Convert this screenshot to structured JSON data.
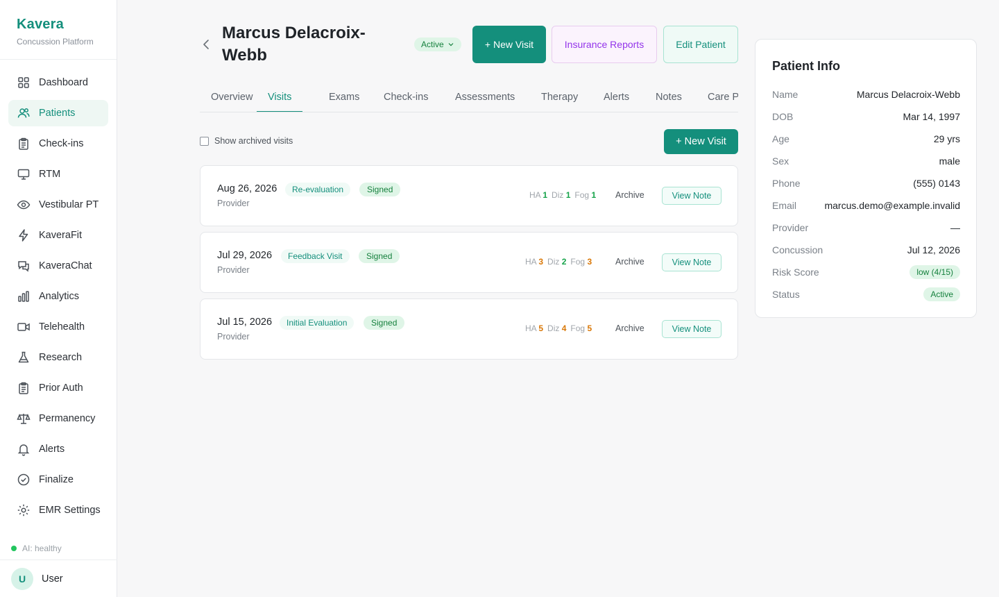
{
  "brand": {
    "name": "Kavera",
    "subtitle": "Concussion Platform"
  },
  "sidebar": {
    "items": [
      {
        "label": "Dashboard",
        "icon": "grid-icon"
      },
      {
        "label": "Patients",
        "icon": "users-icon",
        "active": true
      },
      {
        "label": "Check-ins",
        "icon": "clipboard-icon"
      },
      {
        "label": "RTM",
        "icon": "monitor-icon"
      },
      {
        "label": "Vestibular PT",
        "icon": "eye-icon"
      },
      {
        "label": "KaveraFit",
        "icon": "bolt-icon"
      },
      {
        "label": "KaveraChat",
        "icon": "chat-icon"
      },
      {
        "label": "Analytics",
        "icon": "bar-chart-icon"
      },
      {
        "label": "Telehealth",
        "icon": "video-icon"
      },
      {
        "label": "Research",
        "icon": "flask-icon"
      },
      {
        "label": "Prior Auth",
        "icon": "clipboard-icon"
      },
      {
        "label": "Permanency",
        "icon": "scale-icon"
      },
      {
        "label": "Alerts",
        "icon": "bell-icon"
      },
      {
        "label": "Finalize",
        "icon": "check-circle-icon"
      },
      {
        "label": "EMR Settings",
        "icon": "gear-icon"
      }
    ],
    "ai_status": "AI: healthy",
    "user": {
      "initial": "U",
      "name": "User"
    }
  },
  "header": {
    "title": "Marcus Delacroix-Webb",
    "status": "Active",
    "buttons": {
      "new_visit": "+ New Visit",
      "insurance": "Insurance Reports",
      "edit": "Edit Patient"
    }
  },
  "tabs": [
    "Overview",
    "Visits",
    "Exams",
    "Check-ins",
    "Assessments",
    "Therapy",
    "Alerts",
    "Notes",
    "Care P"
  ],
  "active_tab": "Visits",
  "toolbar": {
    "show_archived": "Show archived visits",
    "new_visit": "+ New Visit"
  },
  "visits": [
    {
      "date": "Aug 26, 2026",
      "type": "Re-evaluation",
      "status": "Signed",
      "provider": "Provider",
      "ha_label": "HA",
      "ha": "1",
      "diz_label": "Diz",
      "diz": "1",
      "fog_label": "Fog",
      "fog": "1",
      "archive": "Archive",
      "view": "View Note"
    },
    {
      "date": "Jul 29, 2026",
      "type": "Feedback Visit",
      "status": "Signed",
      "provider": "Provider",
      "ha_label": "HA",
      "ha": "3",
      "diz_label": "Diz",
      "diz": "2",
      "fog_label": "Fog",
      "fog": "3",
      "archive": "Archive",
      "view": "View Note"
    },
    {
      "date": "Jul 15, 2026",
      "type": "Initial Evaluation",
      "status": "Signed",
      "provider": "Provider",
      "ha_label": "HA",
      "ha": "5",
      "diz_label": "Diz",
      "diz": "4",
      "fog_label": "Fog",
      "fog": "5",
      "archive": "Archive",
      "view": "View Note"
    }
  ],
  "patient_info": {
    "title": "Patient Info",
    "rows": [
      {
        "label": "Name",
        "value": "Marcus Delacroix-Webb"
      },
      {
        "label": "DOB",
        "value": "Mar 14, 1997"
      },
      {
        "label": "Age",
        "value": "29 yrs"
      },
      {
        "label": "Sex",
        "value": "male"
      },
      {
        "label": "Phone",
        "value": "(555) 0143"
      },
      {
        "label": "Email",
        "value": "marcus.demo@example.invalid"
      },
      {
        "label": "Provider",
        "value": "—"
      },
      {
        "label": "Concussion",
        "value": "Jul 12, 2026"
      },
      {
        "label": "Risk Score",
        "value": "low (4/15)"
      },
      {
        "label": "Status",
        "value": "Active"
      }
    ]
  },
  "colors": {
    "brand": "#148f7c",
    "signed": "#15803d",
    "purple": "#9333ea",
    "amber": "#d97706",
    "green": "#16a34a"
  }
}
